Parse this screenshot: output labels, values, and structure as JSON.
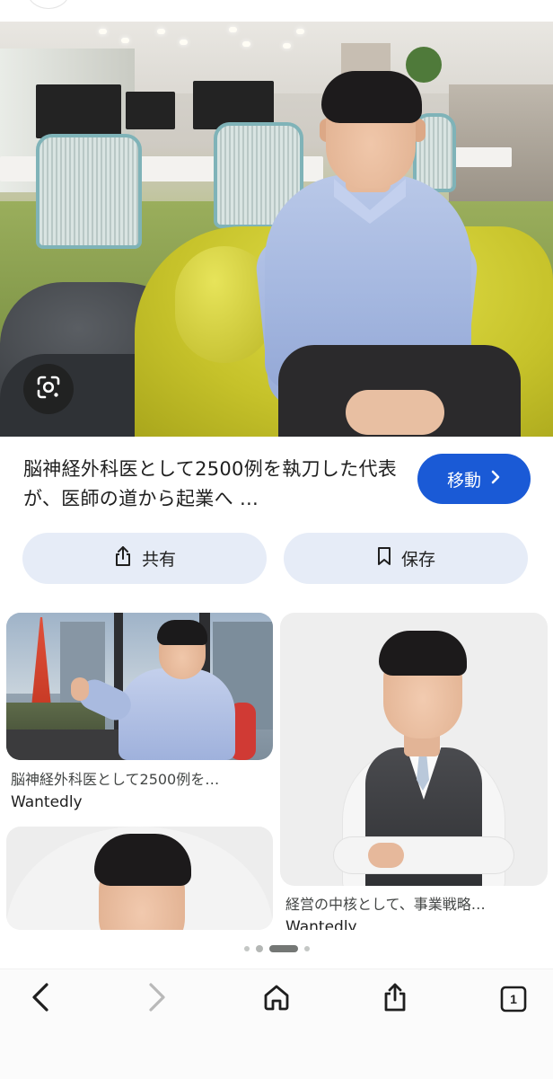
{
  "result": {
    "title": "脳神経外科医として2500例を執刀した代表が、医師の道から起業へ …",
    "visit_label": "移動",
    "share_label": "共有",
    "save_label": "保存"
  },
  "related": [
    {
      "title": "脳神経外科医として2500例を…",
      "source": "Wantedly"
    },
    {
      "title": "経営の中核として、事業戦略…",
      "source": "Wantedly"
    }
  ],
  "pager": {
    "count": 4,
    "active_index": 2
  },
  "toolbar": {
    "tabs_count": "1"
  },
  "icons": [
    "google-lens-icon",
    "share-icon",
    "bookmark-icon",
    "back-arrow-icon",
    "forward-arrow-icon",
    "home-icon",
    "share-upload-icon",
    "tabs-icon"
  ],
  "colors": {
    "accent": "#1a5ad6",
    "pill_bg": "#e6ecf7"
  }
}
